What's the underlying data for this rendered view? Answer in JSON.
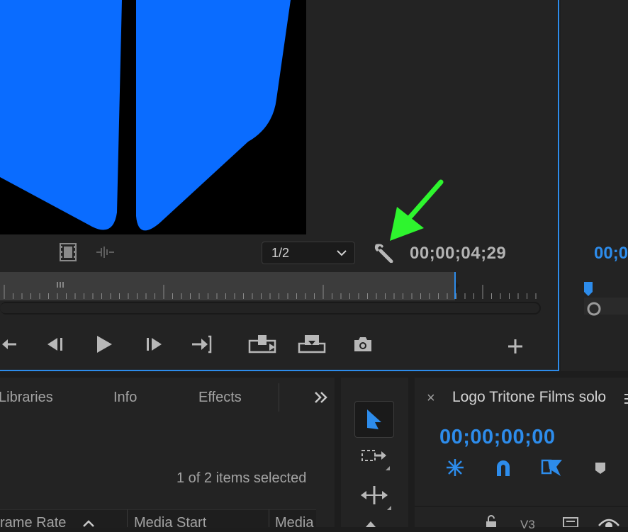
{
  "source_monitor": {
    "resolution": "1/2",
    "timecode": "00;00;04;29"
  },
  "program_monitor": {
    "timecode": "00;0"
  },
  "project_panel": {
    "tabs": [
      "Libraries",
      "Info",
      "Effects"
    ],
    "more_label": "»",
    "items_selected": "1 of 2 items selected",
    "columns": [
      "rame Rate",
      "Media Start",
      "Media"
    ]
  },
  "sequence": {
    "title": "Logo Tritone Films solo",
    "close_label": "×",
    "timecode": "00;00;00;00",
    "track_label": "V3"
  },
  "colors": {
    "accent": "#2d8ceb",
    "video_shape": "#0a6cff",
    "annotation_arrow": "#2ef52e"
  },
  "icons": {
    "drag_video": "film-icon",
    "drag_audio": "waveform-icon",
    "settings": "wrench-icon",
    "export_frame": "camera-icon",
    "add": "plus-icon"
  }
}
